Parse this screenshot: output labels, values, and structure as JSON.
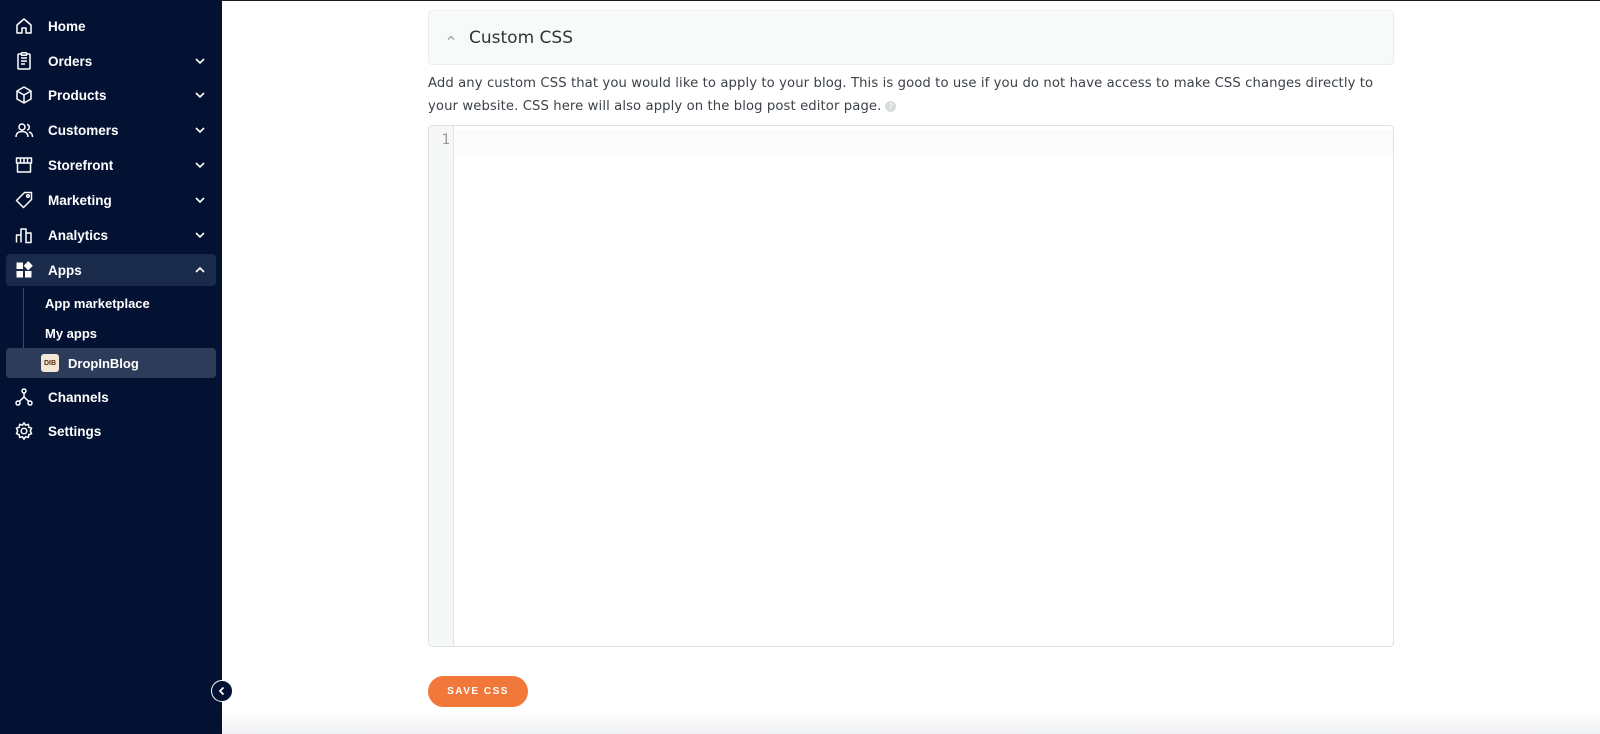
{
  "sidebar": {
    "items": [
      {
        "label": "Home",
        "icon": "home-icon"
      },
      {
        "label": "Orders",
        "icon": "orders-icon"
      },
      {
        "label": "Products",
        "icon": "products-icon"
      },
      {
        "label": "Customers",
        "icon": "customers-icon"
      },
      {
        "label": "Storefront",
        "icon": "storefront-icon"
      },
      {
        "label": "Marketing",
        "icon": "marketing-icon"
      },
      {
        "label": "Analytics",
        "icon": "analytics-icon"
      },
      {
        "label": "Apps",
        "icon": "apps-icon",
        "expanded": true
      },
      {
        "label": "Channels",
        "icon": "channels-icon"
      },
      {
        "label": "Settings",
        "icon": "settings-icon"
      }
    ],
    "apps_subitems": [
      {
        "label": "App marketplace"
      },
      {
        "label": "My apps"
      },
      {
        "label": "DropInBlog",
        "active": true,
        "logo_text": "DIB"
      }
    ]
  },
  "panel": {
    "title": "Custom CSS",
    "description": "Add any custom CSS that you would like to apply to your blog. This is good to use if you do not have access to make CSS changes directly to your website. CSS here will also apply on the blog post editor page.",
    "help_icon_glyph": "?"
  },
  "editor": {
    "line_number": "1",
    "content": ""
  },
  "save_button": {
    "label": "SAVE CSS"
  },
  "colors": {
    "sidebar_bg": "#031233",
    "accent": "#f1773a"
  }
}
